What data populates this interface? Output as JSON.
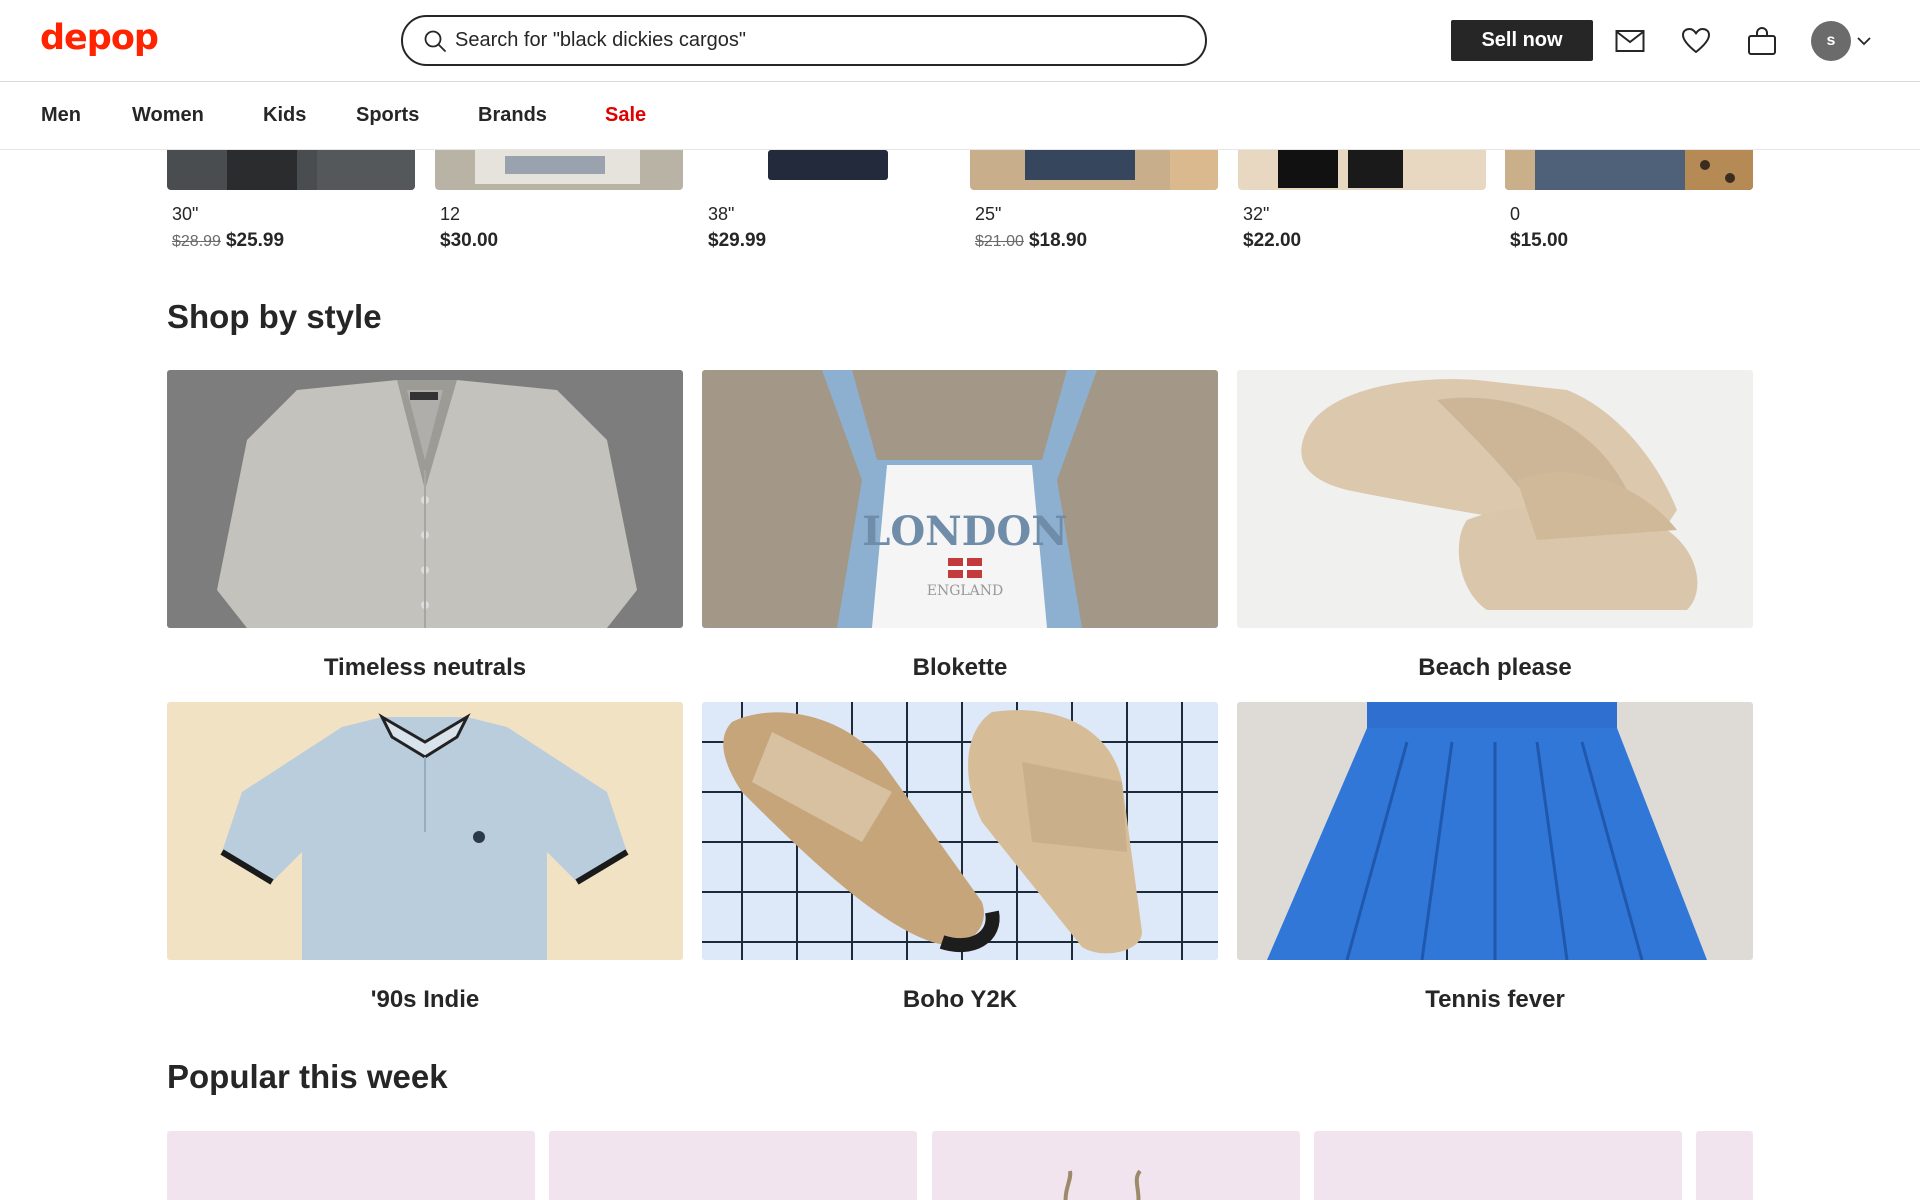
{
  "header": {
    "logo": "depop",
    "search_placeholder": "Search for \"black dickies cargos\"",
    "sell_label": "Sell now",
    "avatar_initial": "s"
  },
  "nav": {
    "items": [
      "Men",
      "Women",
      "Kids",
      "Sports",
      "Brands",
      "Sale"
    ]
  },
  "products": [
    {
      "size": "30\"",
      "old_price": "$28.99",
      "price": "$25.99"
    },
    {
      "size": "12",
      "old_price": "",
      "price": "$30.00"
    },
    {
      "size": "38\"",
      "old_price": "",
      "price": "$29.99"
    },
    {
      "size": "25\"",
      "old_price": "$21.00",
      "price": "$18.90"
    },
    {
      "size": "32\"",
      "old_price": "",
      "price": "$22.00"
    },
    {
      "size": "0",
      "old_price": "",
      "price": "$15.00"
    }
  ],
  "shop_by_style": {
    "title": "Shop by style",
    "tiles": [
      {
        "label": "Timeless neutrals"
      },
      {
        "label": "Blokette",
        "print_main": "LONDON",
        "print_sub": "ENGLAND"
      },
      {
        "label": "Beach please"
      },
      {
        "label": "'90s Indie"
      },
      {
        "label": "Boho Y2K"
      },
      {
        "label": "Tennis fever"
      }
    ]
  },
  "popular": {
    "title": "Popular this week"
  },
  "colors": {
    "brand": "#ff2300",
    "sale": "#e00000",
    "text": "#262626",
    "popular_bg": "#f2e4ef"
  },
  "icons": {
    "search": "magnifier-icon",
    "messages": "envelope-icon",
    "likes": "heart-icon",
    "bag": "shopping-bag-icon",
    "account_menu": "chevron-down-icon"
  }
}
